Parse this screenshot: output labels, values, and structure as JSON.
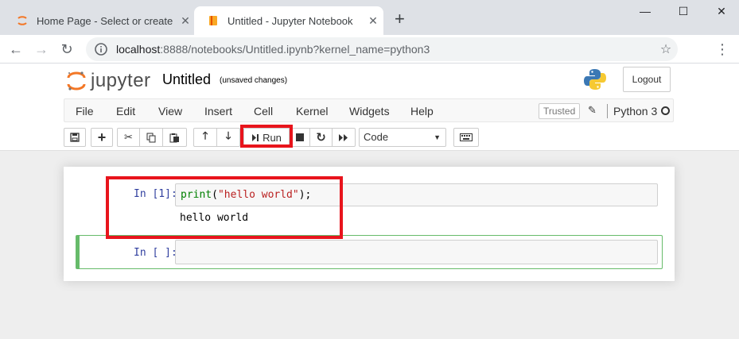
{
  "browser": {
    "tabs": [
      {
        "title": "Home Page - Select or create a",
        "active": false
      },
      {
        "title": "Untitled - Jupyter Notebook",
        "active": true
      }
    ],
    "new_tab_icon": "plus-icon",
    "url_host": "localhost",
    "url_rest": ":8888/notebooks/Untitled.ipynb?kernel_name=python3",
    "controls": {
      "minimize": "—",
      "maximize": "☐",
      "close": "✕"
    }
  },
  "jupyter": {
    "logo_text": "jupyter",
    "notebook_name": "Untitled",
    "save_status": "(unsaved changes)",
    "logout_label": "Logout",
    "menu": [
      "File",
      "Edit",
      "View",
      "Insert",
      "Cell",
      "Kernel",
      "Widgets",
      "Help"
    ],
    "trusted_label": "Trusted",
    "kernel_name": "Python 3",
    "run_label": "Run",
    "cell_type": "Code"
  },
  "cells": [
    {
      "prompt": "In [1]:",
      "code_fn": "print",
      "code_open": "(",
      "code_str": "\"hello world\"",
      "code_close": ");",
      "output": "hello world"
    },
    {
      "prompt": "In [ ]:",
      "code": ""
    }
  ],
  "colors": {
    "highlight": "#e8141c",
    "jupyter_orange": "#f37726",
    "selected_cell": "#66bb6a",
    "prompt_blue": "#303f9f"
  }
}
